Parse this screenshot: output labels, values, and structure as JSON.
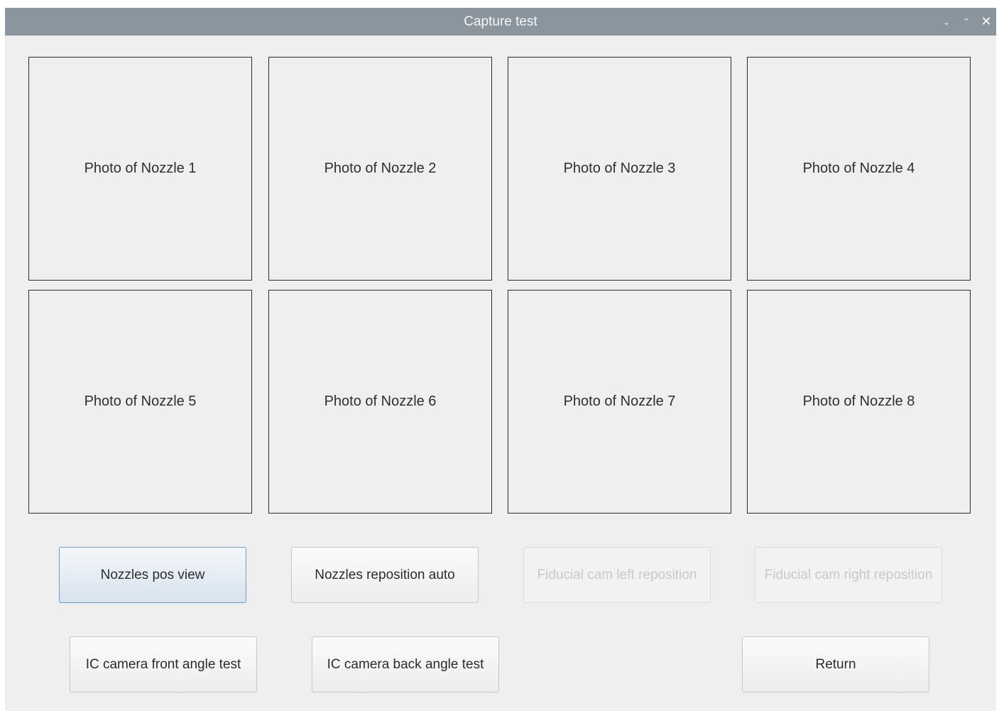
{
  "window": {
    "title": "Capture test",
    "controls": {
      "minimize": "⌄",
      "maximize": "⌃",
      "close": "✕"
    }
  },
  "photos": [
    "Photo of Nozzle 1",
    "Photo of Nozzle 2",
    "Photo of Nozzle 3",
    "Photo of Nozzle 4",
    "Photo of Nozzle 5",
    "Photo of Nozzle 6",
    "Photo of Nozzle 7",
    "Photo of Nozzle 8"
  ],
  "buttons": {
    "nozzles_pos_view": "Nozzles pos view",
    "nozzles_reposition_auto": "Nozzles reposition auto",
    "fiducial_cam_left": "Fiducial cam left reposition",
    "fiducial_cam_right": "Fiducial cam right reposition",
    "ic_front": "IC camera front angle test",
    "ic_back": "IC camera back angle test",
    "return": "Return"
  },
  "colors": {
    "titlebar": "#8a959e",
    "window_bg": "#efefef",
    "active_button": "#d7e3ee",
    "disabled_text": "#c9c9c9"
  }
}
